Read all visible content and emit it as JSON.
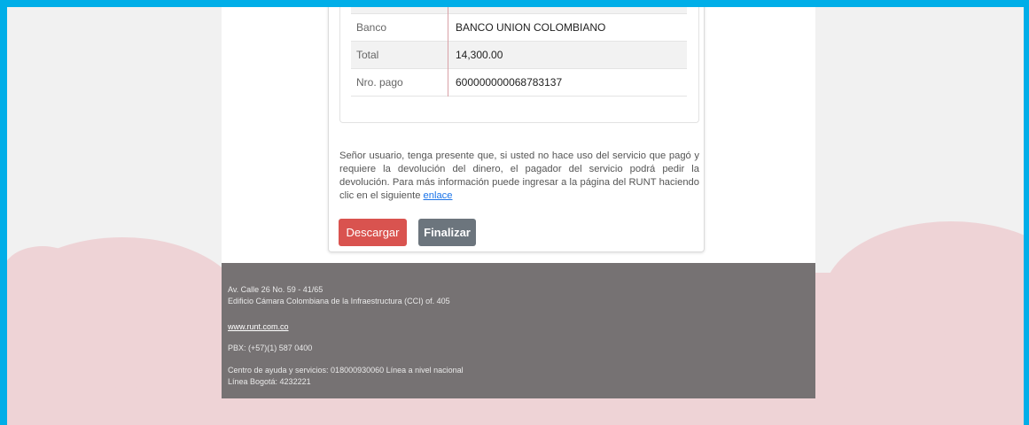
{
  "payment": {
    "rows": [
      {
        "label": "Banco",
        "value": "BANCO UNION COLOMBIANO"
      },
      {
        "label": "Total",
        "value": "14,300.00"
      },
      {
        "label": "Nro. pago",
        "value": "600000000068783137"
      }
    ]
  },
  "notice": {
    "text": "Señor usuario, tenga presente que, si usted no hace uso del servicio que pagó y requiere la devolución del dinero, el pagador del servicio podrá pedir la devolución. Para más información puede ingresar a la página del RUNT haciendo clic en el siguiente",
    "link_label": "enlace"
  },
  "buttons": {
    "download_label": "Descargar",
    "finish_label": "Finalizar"
  },
  "footer": {
    "address_line1": "Av. Calle 26 No. 59 - 41/65",
    "address_line2": "Edificio Cámara Colombiana de la Infraestructura (CCI) of. 405",
    "website": "www.runt.com.co",
    "pbx": "PBX: (+57)(1) 587 0400",
    "help_line": "Centro de ayuda y servicios: 018000930060 Línea a nivel nacional",
    "bogota_line": "Línea Bogotá: 4232221"
  },
  "colors": {
    "frame": "#00aee8",
    "cloud": "#eed3d6",
    "download_button": "#d9534f",
    "finish_button": "#6c757d",
    "footer_bg": "#767273"
  }
}
